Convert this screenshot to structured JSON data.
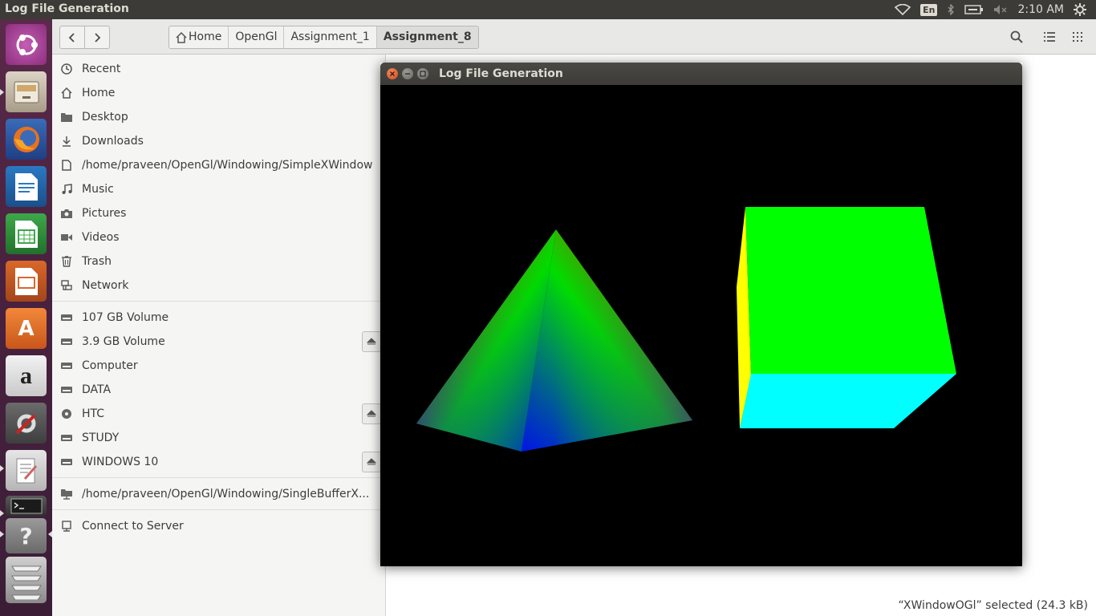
{
  "top_panel": {
    "title": "Log File Generation",
    "keyboard": "En",
    "clock": "2:10 AM"
  },
  "launcher": {
    "items": [
      "ubuntu-dash",
      "files",
      "firefox",
      "libreoffice-writer",
      "libreoffice-calc",
      "libreoffice-impress",
      "software-center",
      "amazon",
      "system-settings",
      "text-editor",
      "terminal",
      "help",
      "workspaces"
    ]
  },
  "files": {
    "pathbar": [
      "Home",
      "OpenGl",
      "Assignment_1",
      "Assignment_8"
    ],
    "sidebar": [
      {
        "label": "Recent",
        "icon": "clock-icon"
      },
      {
        "label": "Home",
        "icon": "home-icon"
      },
      {
        "label": "Desktop",
        "icon": "folder-icon"
      },
      {
        "label": "Downloads",
        "icon": "download-icon"
      },
      {
        "label": "/home/praveen/OpenGl/Windowing/SimpleXWindow",
        "icon": "file-icon"
      },
      {
        "label": "Music",
        "icon": "music-icon"
      },
      {
        "label": "Pictures",
        "icon": "camera-icon"
      },
      {
        "label": "Videos",
        "icon": "video-icon"
      },
      {
        "label": "Trash",
        "icon": "trash-icon"
      },
      {
        "label": "Network",
        "icon": "network-icon"
      },
      {
        "label": "107 GB Volume",
        "icon": "drive-icon"
      },
      {
        "label": "3.9 GB Volume",
        "icon": "drive-icon"
      },
      {
        "label": "Computer",
        "icon": "drive-icon"
      },
      {
        "label": "DATA",
        "icon": "drive-icon"
      },
      {
        "label": "HTC",
        "icon": "disc-icon"
      },
      {
        "label": "STUDY",
        "icon": "drive-icon"
      },
      {
        "label": "WINDOWS 10",
        "icon": "drive-icon"
      },
      {
        "label": "/home/praveen/OpenGl/Windowing/SingleBufferX...",
        "icon": "folder-remote-icon"
      },
      {
        "label": "Connect to Server",
        "icon": "server-icon"
      }
    ],
    "status": "“XWindowOGl” selected  (24.3 kB)"
  },
  "gl_window": {
    "title": "Log File Generation",
    "colors": {
      "pyramid_apex": "#ff0000",
      "pyramid_mid": "#00dd00",
      "pyramid_base": "#0000ff",
      "cube_front": "#00ff00",
      "cube_bottom": "#00ffff",
      "cube_side": "#ffff00"
    }
  }
}
